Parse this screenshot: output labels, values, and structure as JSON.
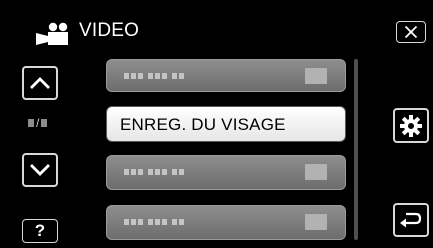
{
  "header": {
    "title": "VIDEO",
    "mode_icon": "video-camera-icon"
  },
  "buttons": {
    "close_icon": "close-icon",
    "up_icon": "chevron-up-icon",
    "down_icon": "chevron-down-icon",
    "help_label": "?",
    "settings_icon": "gear-icon",
    "back_icon": "return-icon"
  },
  "page_indicator": {
    "separator": "/"
  },
  "menu": {
    "items": [
      {
        "label": "",
        "state": "disabled"
      },
      {
        "label": "ENREG. DU VISAGE",
        "state": "enabled"
      },
      {
        "label": "",
        "state": "disabled"
      },
      {
        "label": "",
        "state": "disabled"
      }
    ]
  },
  "colors": {
    "background": "#000000",
    "enabled_item": "#ffffff",
    "disabled_item": "#7a7a7a",
    "button_border": "#d8d8d8"
  }
}
